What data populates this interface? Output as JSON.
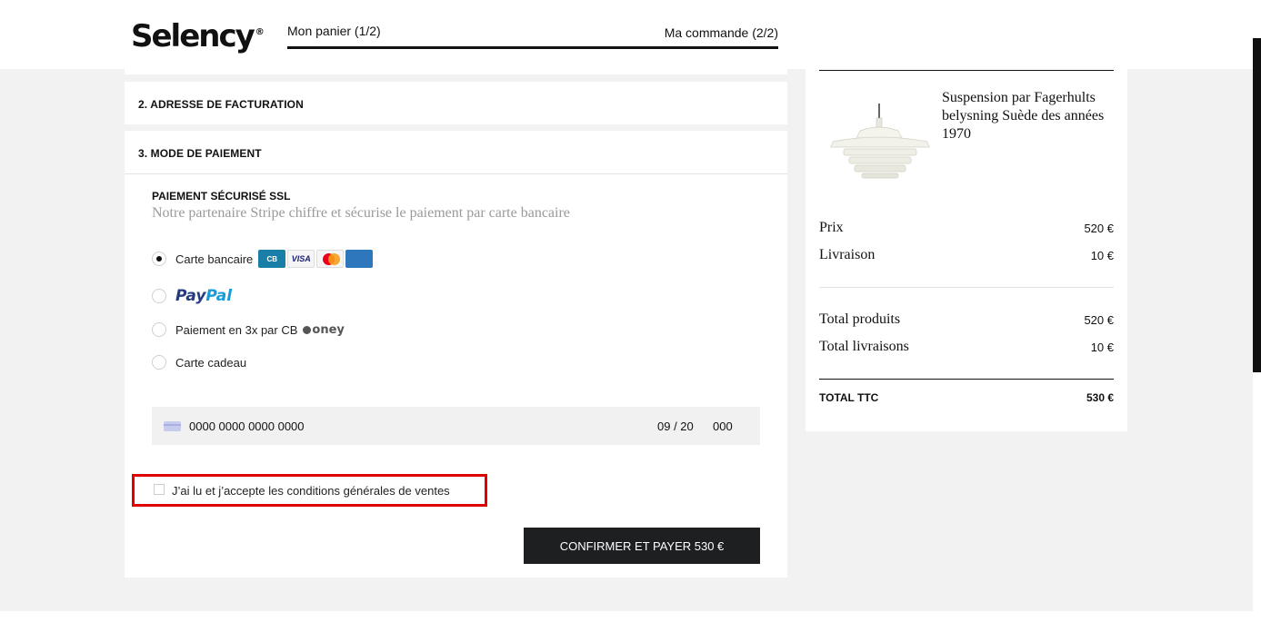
{
  "header": {
    "logo": "Selency",
    "logo_mark": "®",
    "step1": "Mon panier (1/2)",
    "step2": "Ma commande (2/2)"
  },
  "billing": {
    "title": "2. ADRESSE DE FACTURATION"
  },
  "payment": {
    "title": "3. MODE DE PAIEMENT",
    "ssl_title": "PAIEMENT SÉCURISÉ SSL",
    "ssl_desc": "Notre partenaire Stripe chiffre et sécurise le paiement par carte bancaire",
    "options": [
      {
        "label": "Carte bancaire",
        "selected": true
      },
      {
        "label": "PayPal",
        "selected": false
      },
      {
        "label": "Paiement en 3x par CB",
        "selected": false
      },
      {
        "label": "Carte cadeau",
        "selected": false
      }
    ],
    "card_logos": [
      "CB",
      "VISA",
      "Mastercard",
      "American Express"
    ],
    "paypal_logo": {
      "part1": "Pay",
      "part2": "Pal"
    },
    "oney_logo": "oney",
    "card_number_placeholder": "0000 0000 0000 0000",
    "card_expiry_placeholder": "09 / 20",
    "card_cvc_placeholder": "000",
    "cgv_label": "J’ai lu et j’accepte les conditions générales de ventes",
    "cgv_checked": false,
    "pay_button": "CONFIRMER ET PAYER 530 €"
  },
  "summary": {
    "product_name": "Suspension par Fagerhults belysning Suède des années 1970",
    "price_label": "Prix",
    "price_value": "520 €",
    "delivery_label": "Livraison",
    "delivery_value": "10 €",
    "total_products_label": "Total produits",
    "total_products_value": "520 €",
    "total_delivery_label": "Total livraisons",
    "total_delivery_value": "10 €",
    "total_label": "TOTAL TTC",
    "total_value": "530 €"
  },
  "colors": {
    "highlight_border": "#e00000",
    "button_bg": "#1e1f21",
    "page_bg": "#f2f2f2"
  }
}
